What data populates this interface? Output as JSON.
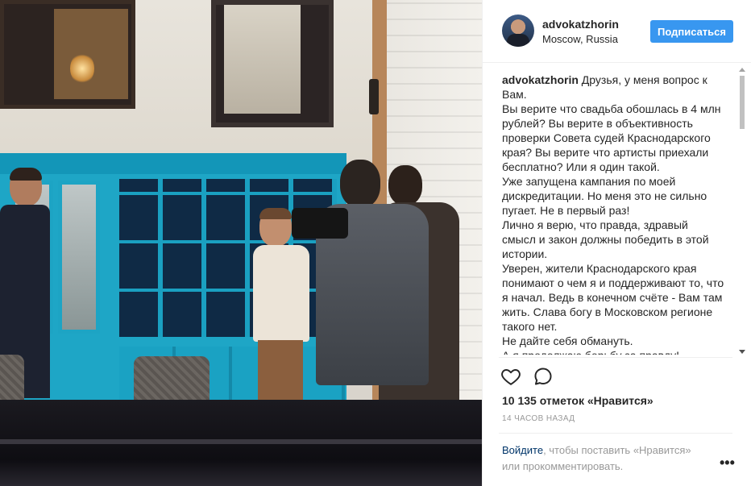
{
  "header": {
    "username": "advokatzhorin",
    "location": "Moscow, Russia",
    "follow_label": "Подписаться"
  },
  "caption": {
    "username": "advokatzhorin",
    "text": " Друзья, у меня вопрос к Вам.\nВы верите что свадьба обошлась в 4 млн рублей? Вы верите в объективность проверки Совета судей Краснодарского края? Вы верите что артисты приехали бесплатно? Или я один такой.\nУже запущена кампания по моей дискредитации. Но меня это не сильно пугает. Не в первый раз!\nЛично я верю, что правда, здравый смысл и закон должны победить в этой истории.\nУверен, жители Краснодарского края понимают о чем я и поддерживают то, что я начал. Ведь в конечном счёте - Вам там жить. Слава богу в Московском регионе такого нет.\nНе дайте себя обмануть.\nА я продолжаю борьбу за правду!"
  },
  "actions": {
    "like_icon": "heart-outline-icon",
    "comment_icon": "speech-bubble-icon"
  },
  "likes_text": "10 135 отметок «Нравится»",
  "time_ago": "14 ЧАСОВ НАЗАД",
  "login_prompt": {
    "link": "Войдите",
    "rest": ", чтобы поставить «Нравится» или прокомментировать."
  },
  "more_label": "•••",
  "colors": {
    "accent": "#3897f0",
    "link": "#003569",
    "muted": "#999999",
    "text": "#262626"
  }
}
